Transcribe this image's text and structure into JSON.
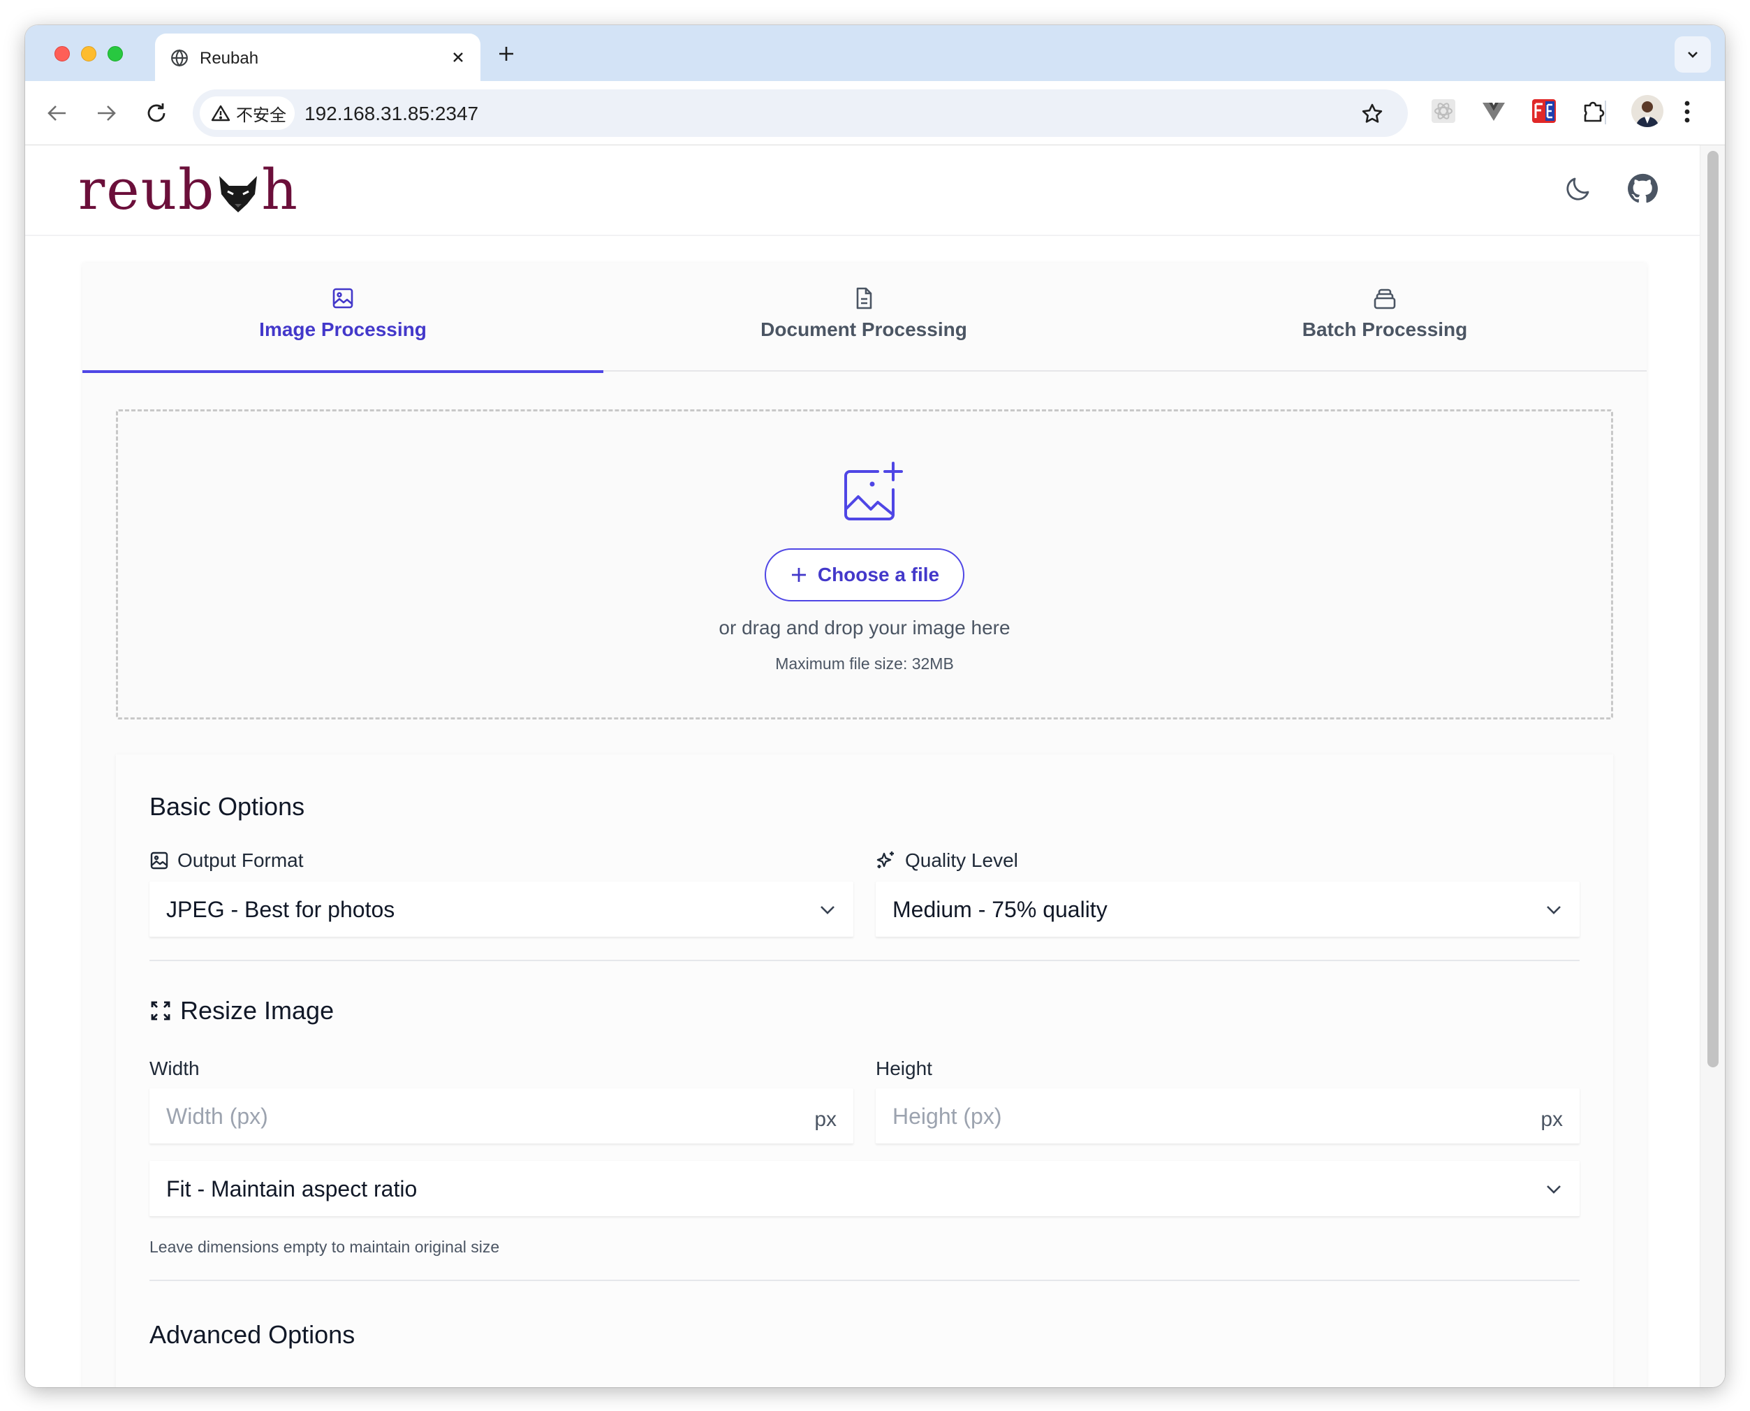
{
  "browser": {
    "tab_title": "Reubah",
    "security_label": "不安全",
    "url": "192.168.31.85:2347"
  },
  "site": {
    "logo_prefix": "reub",
    "logo_suffix": "h"
  },
  "tabs": [
    {
      "label": "Image Processing",
      "icon": "image-icon",
      "active": true
    },
    {
      "label": "Document Processing",
      "icon": "document-icon",
      "active": false
    },
    {
      "label": "Batch Processing",
      "icon": "layers-icon",
      "active": false
    }
  ],
  "upload": {
    "button_label": "Choose a file",
    "drag_text": "or drag and drop your image here",
    "max_size": "Maximum file size: 32MB"
  },
  "basic": {
    "title": "Basic Options",
    "output_format_label": "Output Format",
    "output_format_value": "JPEG - Best for photos",
    "quality_label": "Quality Level",
    "quality_value": "Medium - 75% quality"
  },
  "resize": {
    "title": "Resize Image",
    "width_label": "Width",
    "width_placeholder": "Width (px)",
    "height_label": "Height",
    "height_placeholder": "Height (px)",
    "unit": "px",
    "fit_value": "Fit - Maintain aspect ratio",
    "hint": "Leave dimensions empty to maintain original size"
  },
  "advanced": {
    "title": "Advanced Options"
  },
  "colors": {
    "accent": "#4f46e5",
    "brand": "#6b0f3a"
  }
}
